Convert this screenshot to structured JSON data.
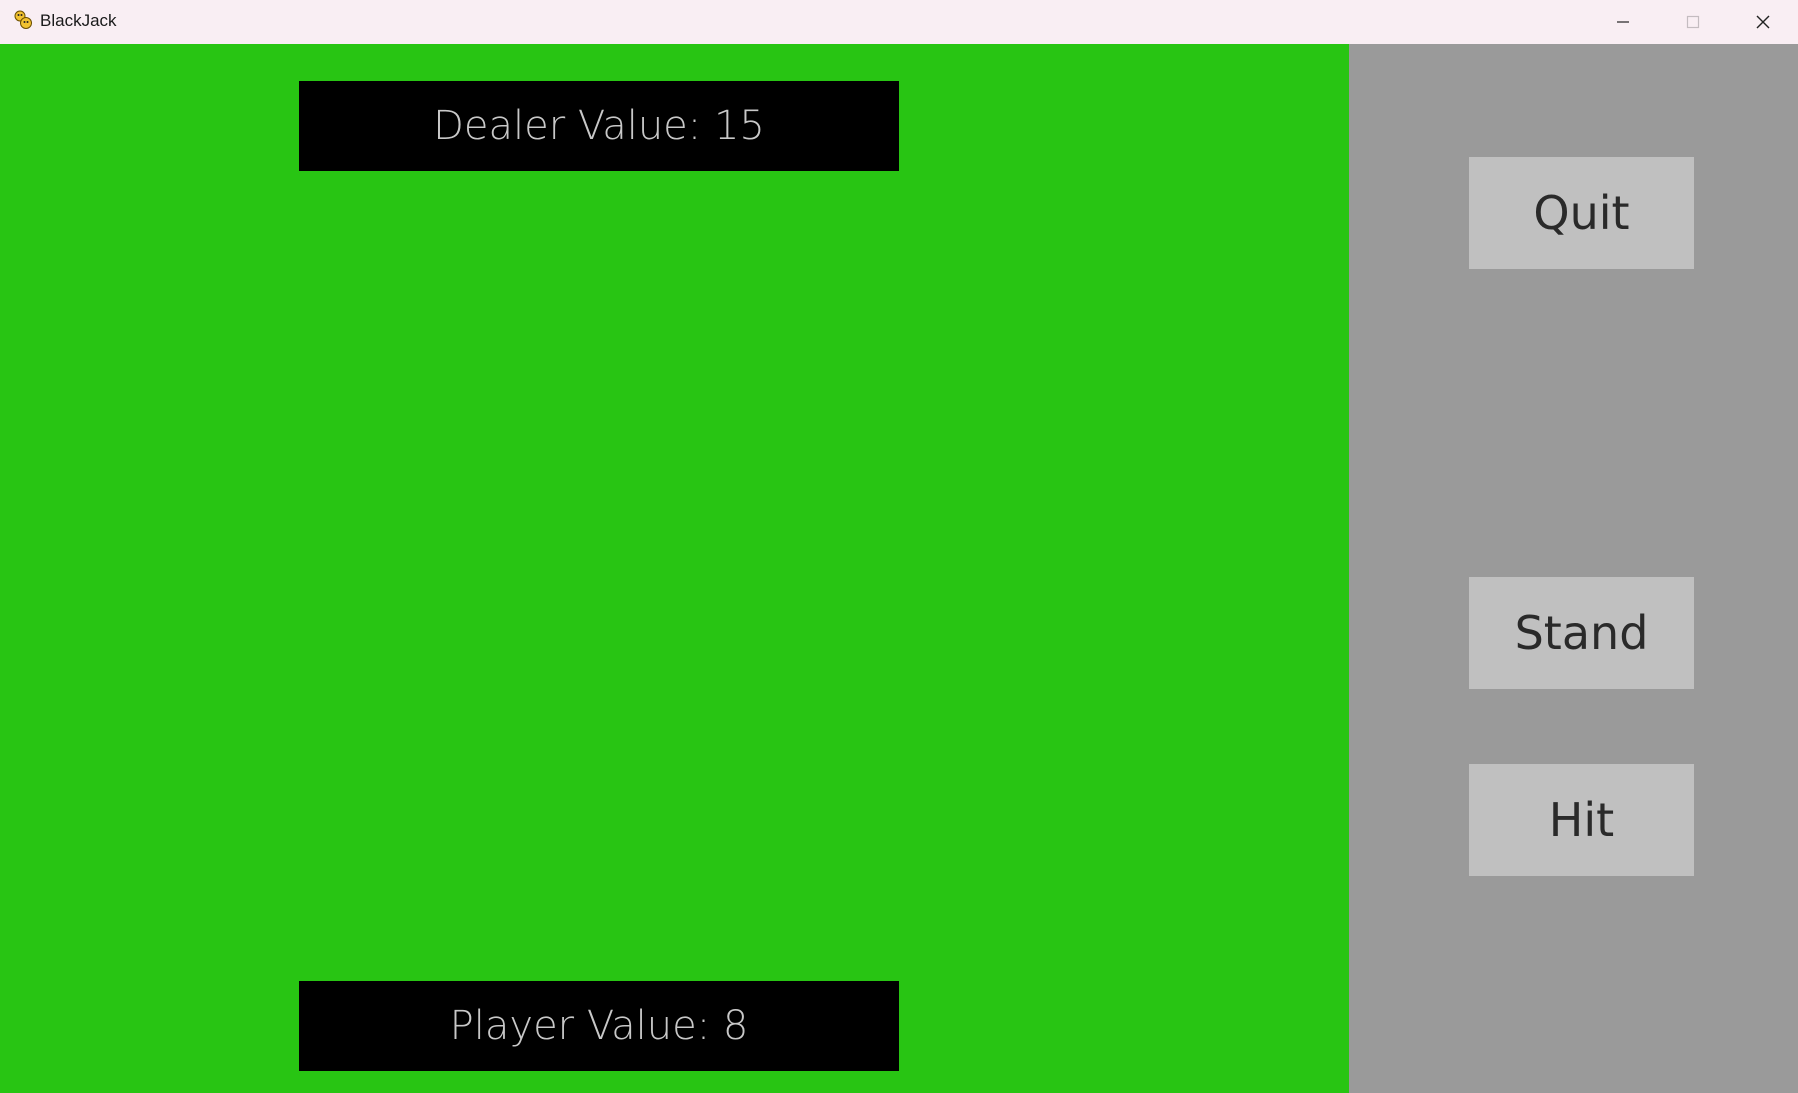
{
  "window": {
    "title": "BlackJack",
    "app_icon": "python-snake-icon",
    "controls": {
      "minimize_icon": "minimize-icon",
      "maximize_icon": "maximize-icon",
      "close_icon": "close-icon"
    }
  },
  "table": {
    "dealer_value_text": "Dealer Value: 15",
    "player_value_text": "Player Value: 8",
    "felt_color": "#28c513"
  },
  "panel": {
    "background_color": "#9a9a9a",
    "buttons": {
      "quit_label": "Quit",
      "stand_label": "Stand",
      "hit_label": "Hit"
    },
    "button_color": "#c0c0c0"
  }
}
